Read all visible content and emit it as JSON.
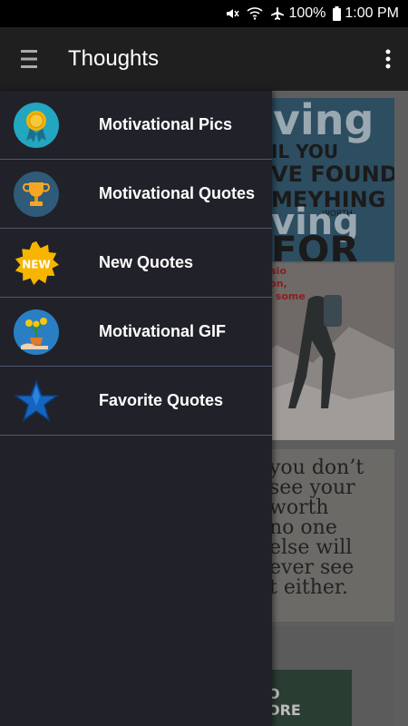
{
  "status_bar": {
    "battery": "100%",
    "time": "1:00 PM"
  },
  "app_bar": {
    "title": "Thoughts"
  },
  "drawer": {
    "items": [
      {
        "label": "Motivational Pics",
        "icon": "medal-icon"
      },
      {
        "label": "Motivational Quotes",
        "icon": "trophy-icon"
      },
      {
        "label": "New Quotes",
        "icon": "new-badge-icon",
        "badge_text": "NEW"
      },
      {
        "label": "Motivational GIF",
        "icon": "money-plant-icon"
      },
      {
        "label": "Favorite Quotes",
        "icon": "star-icon"
      }
    ]
  },
  "background": {
    "card1_lines": [
      "ving",
      "IL YOU",
      "VE FOUND",
      "MEYHING",
      "WORTH",
      "ving",
      "FOR"
    ],
    "card2_lines": [
      "e passio",
      "passion,",
      "r, and some"
    ],
    "card3_lines": [
      "you don’t",
      "see your",
      "worth",
      "no one",
      "else will",
      "ever see",
      "t either."
    ],
    "card4_lines": [
      "O",
      "ORE"
    ]
  },
  "colors": {
    "drawer_bg": "#212129",
    "app_bar_bg": "#1f1f1f",
    "divider": "#4c5a70",
    "text": "#ffffff"
  }
}
